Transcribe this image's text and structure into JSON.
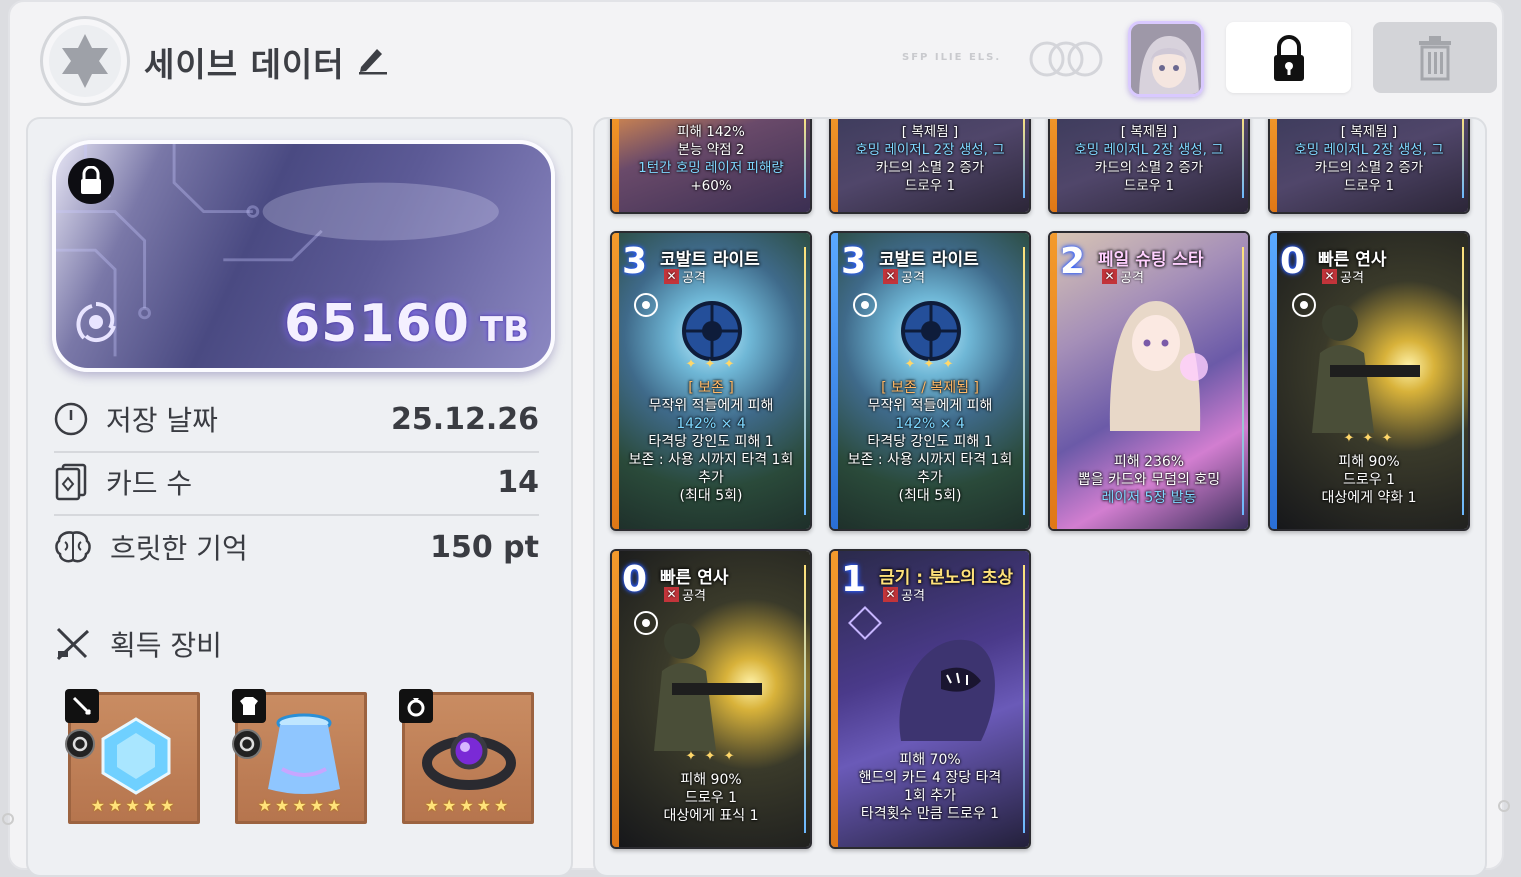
{
  "header": {
    "title": "세이브 데이터",
    "faint_text": "SFP ILIE ELS.",
    "lock_label": "",
    "trash_label": ""
  },
  "storage": {
    "amount": "65160",
    "unit": "TB"
  },
  "stats": [
    {
      "label": "저장 날짜",
      "value": "25.12.26",
      "icon": "clock-icon"
    },
    {
      "label": "카드 수",
      "value": "14",
      "icon": "card-icon"
    },
    {
      "label": "흐릿한 기억",
      "value": "150 pt",
      "icon": "brain-icon"
    }
  ],
  "equipment": {
    "header": "획득 장비",
    "items": [
      {
        "name": "crystal",
        "stars": "★★★★★",
        "tag_icon": "sword-icon"
      },
      {
        "name": "skirt",
        "stars": "★★★★★",
        "tag_icon": "armor-icon"
      },
      {
        "name": "ring",
        "stars": "★★★★★",
        "tag_icon": "ring-icon"
      }
    ]
  },
  "cards_top": [
    {
      "l1": "피해 142%",
      "l2": "본능 약점 2",
      "l3": "1턴간 호밍 레이저 피해량",
      "l4": "+60%"
    },
    {
      "l1": "[ 복제됨 ]",
      "l2": "호밍 레이저L 2장 생성, 그",
      "l3": "카드의 소멸 2 증가",
      "l4": "드로우 1"
    },
    {
      "l1": "[ 복제됨 ]",
      "l2": "호밍 레이저L 2장 생성, 그",
      "l3": "카드의 소멸 2 증가",
      "l4": "드로우 1"
    },
    {
      "l1": "[ 복제됨 ]",
      "l2": "호밍 레이저L 2장 생성, 그",
      "l3": "카드의 소멸 2 증가",
      "l4": "드로우 1"
    }
  ],
  "cards": [
    {
      "cost": "3",
      "name": "코발트 라이트",
      "type": "공격",
      "tag": "[ 보존 ]",
      "d1": "무작위 적들에게 피해",
      "d2": "142% × 4",
      "d3": "타격당 강인도 피해 1",
      "d4": "보존 : 사용 시까지 타격 1회",
      "d5": "추가",
      "d6": "(최대 5회)"
    },
    {
      "cost": "3",
      "name": "코발트 라이트",
      "type": "공격",
      "tag": "[ 보존 / 복제됨 ]",
      "d1": "무작위 적들에게 피해",
      "d2": "142% × 4",
      "d3": "타격당 강인도 피해 1",
      "d4": "보존 : 사용 시까지 타격 1회",
      "d5": "추가",
      "d6": "(최대 5회)"
    },
    {
      "cost": "2",
      "name": "페일 슈팅 스타",
      "type": "공격",
      "d1": "피해 236%",
      "d2": "뽑을 카드와 무덤의 호밍",
      "d3": "레이저 5장 발동"
    },
    {
      "cost": "0",
      "name": "빠른 연사",
      "type": "공격",
      "d1": "피해 90%",
      "d2": "드로우 1",
      "d3": "대상에게 약화 1"
    },
    {
      "cost": "0",
      "name": "빠른 연사",
      "type": "공격",
      "d1": "피해 90%",
      "d2": "드로우 1",
      "d3": "대상에게 표식 1"
    },
    {
      "cost": "1",
      "name": "금기 : 분노의 초상",
      "type": "공격",
      "d1": "피해 70%",
      "d2": "핸드의 카드 4 장당 타격",
      "d3": "1회 추가",
      "d4": "타격횟수 만큼 드로우 1"
    }
  ],
  "colors": {
    "accent_purple": "#6f5fc9",
    "card_orange": "#f39a2c",
    "highlight_blue": "#7fd7ff"
  }
}
